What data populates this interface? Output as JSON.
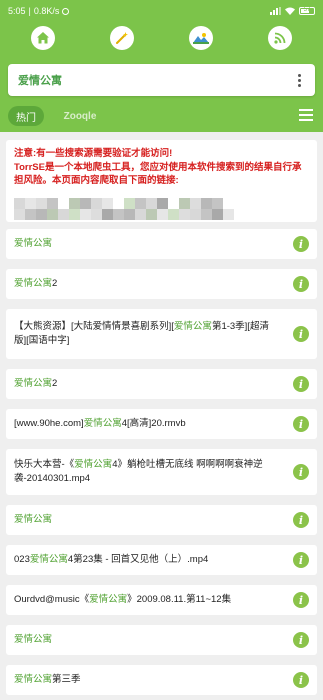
{
  "status_bar": {
    "time": "5:05",
    "speed": "0.8K/s",
    "battery": "57"
  },
  "top_icons": [
    "home-icon",
    "magic-wand-icon",
    "landscape-icon",
    "rss-icon"
  ],
  "search": {
    "query": "爱情公寓"
  },
  "tabs": {
    "hot": "热门",
    "zooqle": "Zooqle"
  },
  "notice": {
    "line1": "注意:有一些搜索源需要验证才能访问!",
    "line2": "TorrSE是一个本地爬虫工具，您应对使用本软件搜索到的结果自行承担风险。本页面内容爬取自下面的链接:"
  },
  "results": [
    {
      "pre": "",
      "kw": "爱情公寓",
      "post": ""
    },
    {
      "pre": "",
      "kw": "爱情公寓",
      "post": "2"
    },
    {
      "pre": "【大熊资源】[大陆爱情情景喜剧系列][",
      "kw": "爱情公寓",
      "post": "第1-3季][超清版][国语中字]"
    },
    {
      "pre": "",
      "kw": "爱情公寓",
      "post": "2"
    },
    {
      "pre": "[www.90he.com]",
      "kw": "爱情公寓",
      "post": "4[高清]20.rmvb"
    },
    {
      "pre": "快乐大本营-《",
      "kw": "爱情公寓",
      "post": "4》躺枪吐槽无底线 啊啊啊啊衰神逆袭-20140301.mp4"
    },
    {
      "pre": "",
      "kw": "爱情公寓",
      "post": ""
    },
    {
      "pre": "023",
      "kw": "爱情公寓",
      "post": "4第23集 - 回首又见他（上）.mp4"
    },
    {
      "pre": "Ourdvd@music《",
      "kw": "爱情公寓",
      "post": "》2009.08.11.第11~12集"
    },
    {
      "pre": "",
      "kw": "爱情公寓",
      "post": ""
    },
    {
      "pre": "",
      "kw": "爱情公寓",
      "post": "第三季"
    }
  ],
  "info_glyph": "i",
  "colors": {
    "primary": "#7cc44a",
    "keyword": "#55a437",
    "warning": "#d6201f",
    "info_button": "#8bc34a"
  }
}
